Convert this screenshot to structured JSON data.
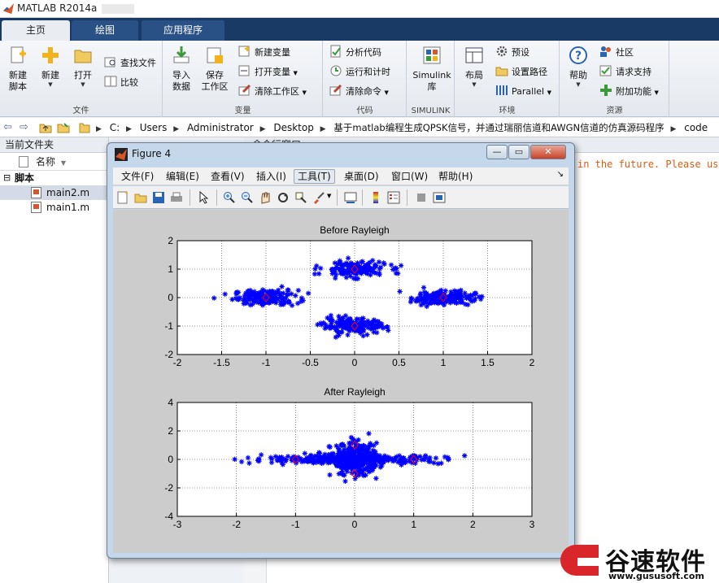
{
  "app": {
    "title": "MATLAB R2014a"
  },
  "colors": {
    "ribbon_tab_bg": "#1a3a66",
    "marker": "#0000ff",
    "center_marker": "#ff0000",
    "warning": "#e05a10"
  },
  "tabs": [
    {
      "label": "主页",
      "active": true
    },
    {
      "label": "绘图",
      "active": false
    },
    {
      "label": "应用程序",
      "active": false
    }
  ],
  "ribbon": {
    "file": {
      "label": "文件",
      "new_script": "新建\n脚本",
      "new": "新建",
      "open": "打开",
      "find_files": "查找文件",
      "compare": "比较"
    },
    "variable": {
      "label": "变量",
      "import_data": "导入\n数据",
      "save_workspace": "保存\n工作区",
      "new_variable": "新建变量",
      "open_variable": "打开变量",
      "clear_workspace": "清除工作区"
    },
    "code": {
      "label": "代码",
      "analyze_code": "分析代码",
      "run_and_time": "运行和计时",
      "clear_commands": "清除命令"
    },
    "simulink": {
      "label": "SIMULINK",
      "library": "Simulink\n库"
    },
    "environment": {
      "label": "环境",
      "layout": "布局",
      "preferences": "预设",
      "set_path": "设置路径",
      "parallel": "Parallel"
    },
    "resources": {
      "label": "资源",
      "help": "帮助",
      "community": "社区",
      "request_support": "请求支持",
      "add_ons": "附加功能"
    }
  },
  "address": {
    "crumbs": [
      "C:",
      "Users",
      "Administrator",
      "Desktop",
      "基于matlab编程生成QPSK信号，并通过瑞丽信道和AWGN信道的仿真源码程序",
      "code"
    ]
  },
  "file_browser": {
    "title": "当前文件夹",
    "column_name": "名称",
    "group": "脚本",
    "files": [
      "main2.m",
      "main1.m"
    ]
  },
  "command_window": {
    "title": "命令行窗口",
    "visible_text": "in the future. Please use"
  },
  "figure": {
    "title": "Figure 4",
    "menu": [
      "文件(F)",
      "编辑(E)",
      "查看(V)",
      "插入(I)",
      "工具(T)",
      "桌面(D)",
      "窗口(W)",
      "帮助(H)"
    ],
    "hover_menu": "工具(T)"
  },
  "chart_data": [
    {
      "type": "scatter",
      "title": "Before Rayleigh",
      "xlim": [
        -2,
        2
      ],
      "ylim": [
        -2,
        2
      ],
      "xticks": [
        "-2",
        "-1.5",
        "-1",
        "-0.5",
        "0",
        "0.5",
        "1",
        "1.5",
        "2"
      ],
      "yticks": [
        "-2",
        "-1",
        "0",
        "1",
        "2"
      ],
      "grid": true,
      "marker": "*",
      "clusters": [
        {
          "center": [
            -1,
            0
          ],
          "spread": [
            0.18,
            0.13
          ]
        },
        {
          "center": [
            1,
            0
          ],
          "spread": [
            0.18,
            0.13
          ]
        },
        {
          "center": [
            0,
            1
          ],
          "spread": [
            0.18,
            0.13
          ]
        },
        {
          "center": [
            0,
            -1
          ],
          "spread": [
            0.18,
            0.13
          ]
        }
      ],
      "centers": [
        [
          -1,
          0
        ],
        [
          1,
          0
        ],
        [
          0,
          1
        ],
        [
          0,
          -1
        ]
      ]
    },
    {
      "type": "scatter",
      "title": "After Rayleigh",
      "xlim": [
        -3,
        3
      ],
      "ylim": [
        -4,
        4
      ],
      "xticks": [
        "-3",
        "-2",
        "-1",
        "0",
        "1",
        "2",
        "3"
      ],
      "yticks": [
        "-4",
        "-2",
        "0",
        "2",
        "4"
      ],
      "grid": true,
      "marker": "*",
      "clusters": [
        {
          "center": [
            0,
            0
          ],
          "spread": [
            0.75,
            0.15
          ]
        },
        {
          "center": [
            0,
            0
          ],
          "spread": [
            0.2,
            0.55
          ]
        }
      ],
      "centers": [
        [
          -1,
          0
        ],
        [
          1,
          0
        ],
        [
          0,
          1
        ],
        [
          0,
          -1
        ]
      ]
    }
  ],
  "watermark": {
    "brand": "谷速软件",
    "url": "www.gususoft.com"
  }
}
